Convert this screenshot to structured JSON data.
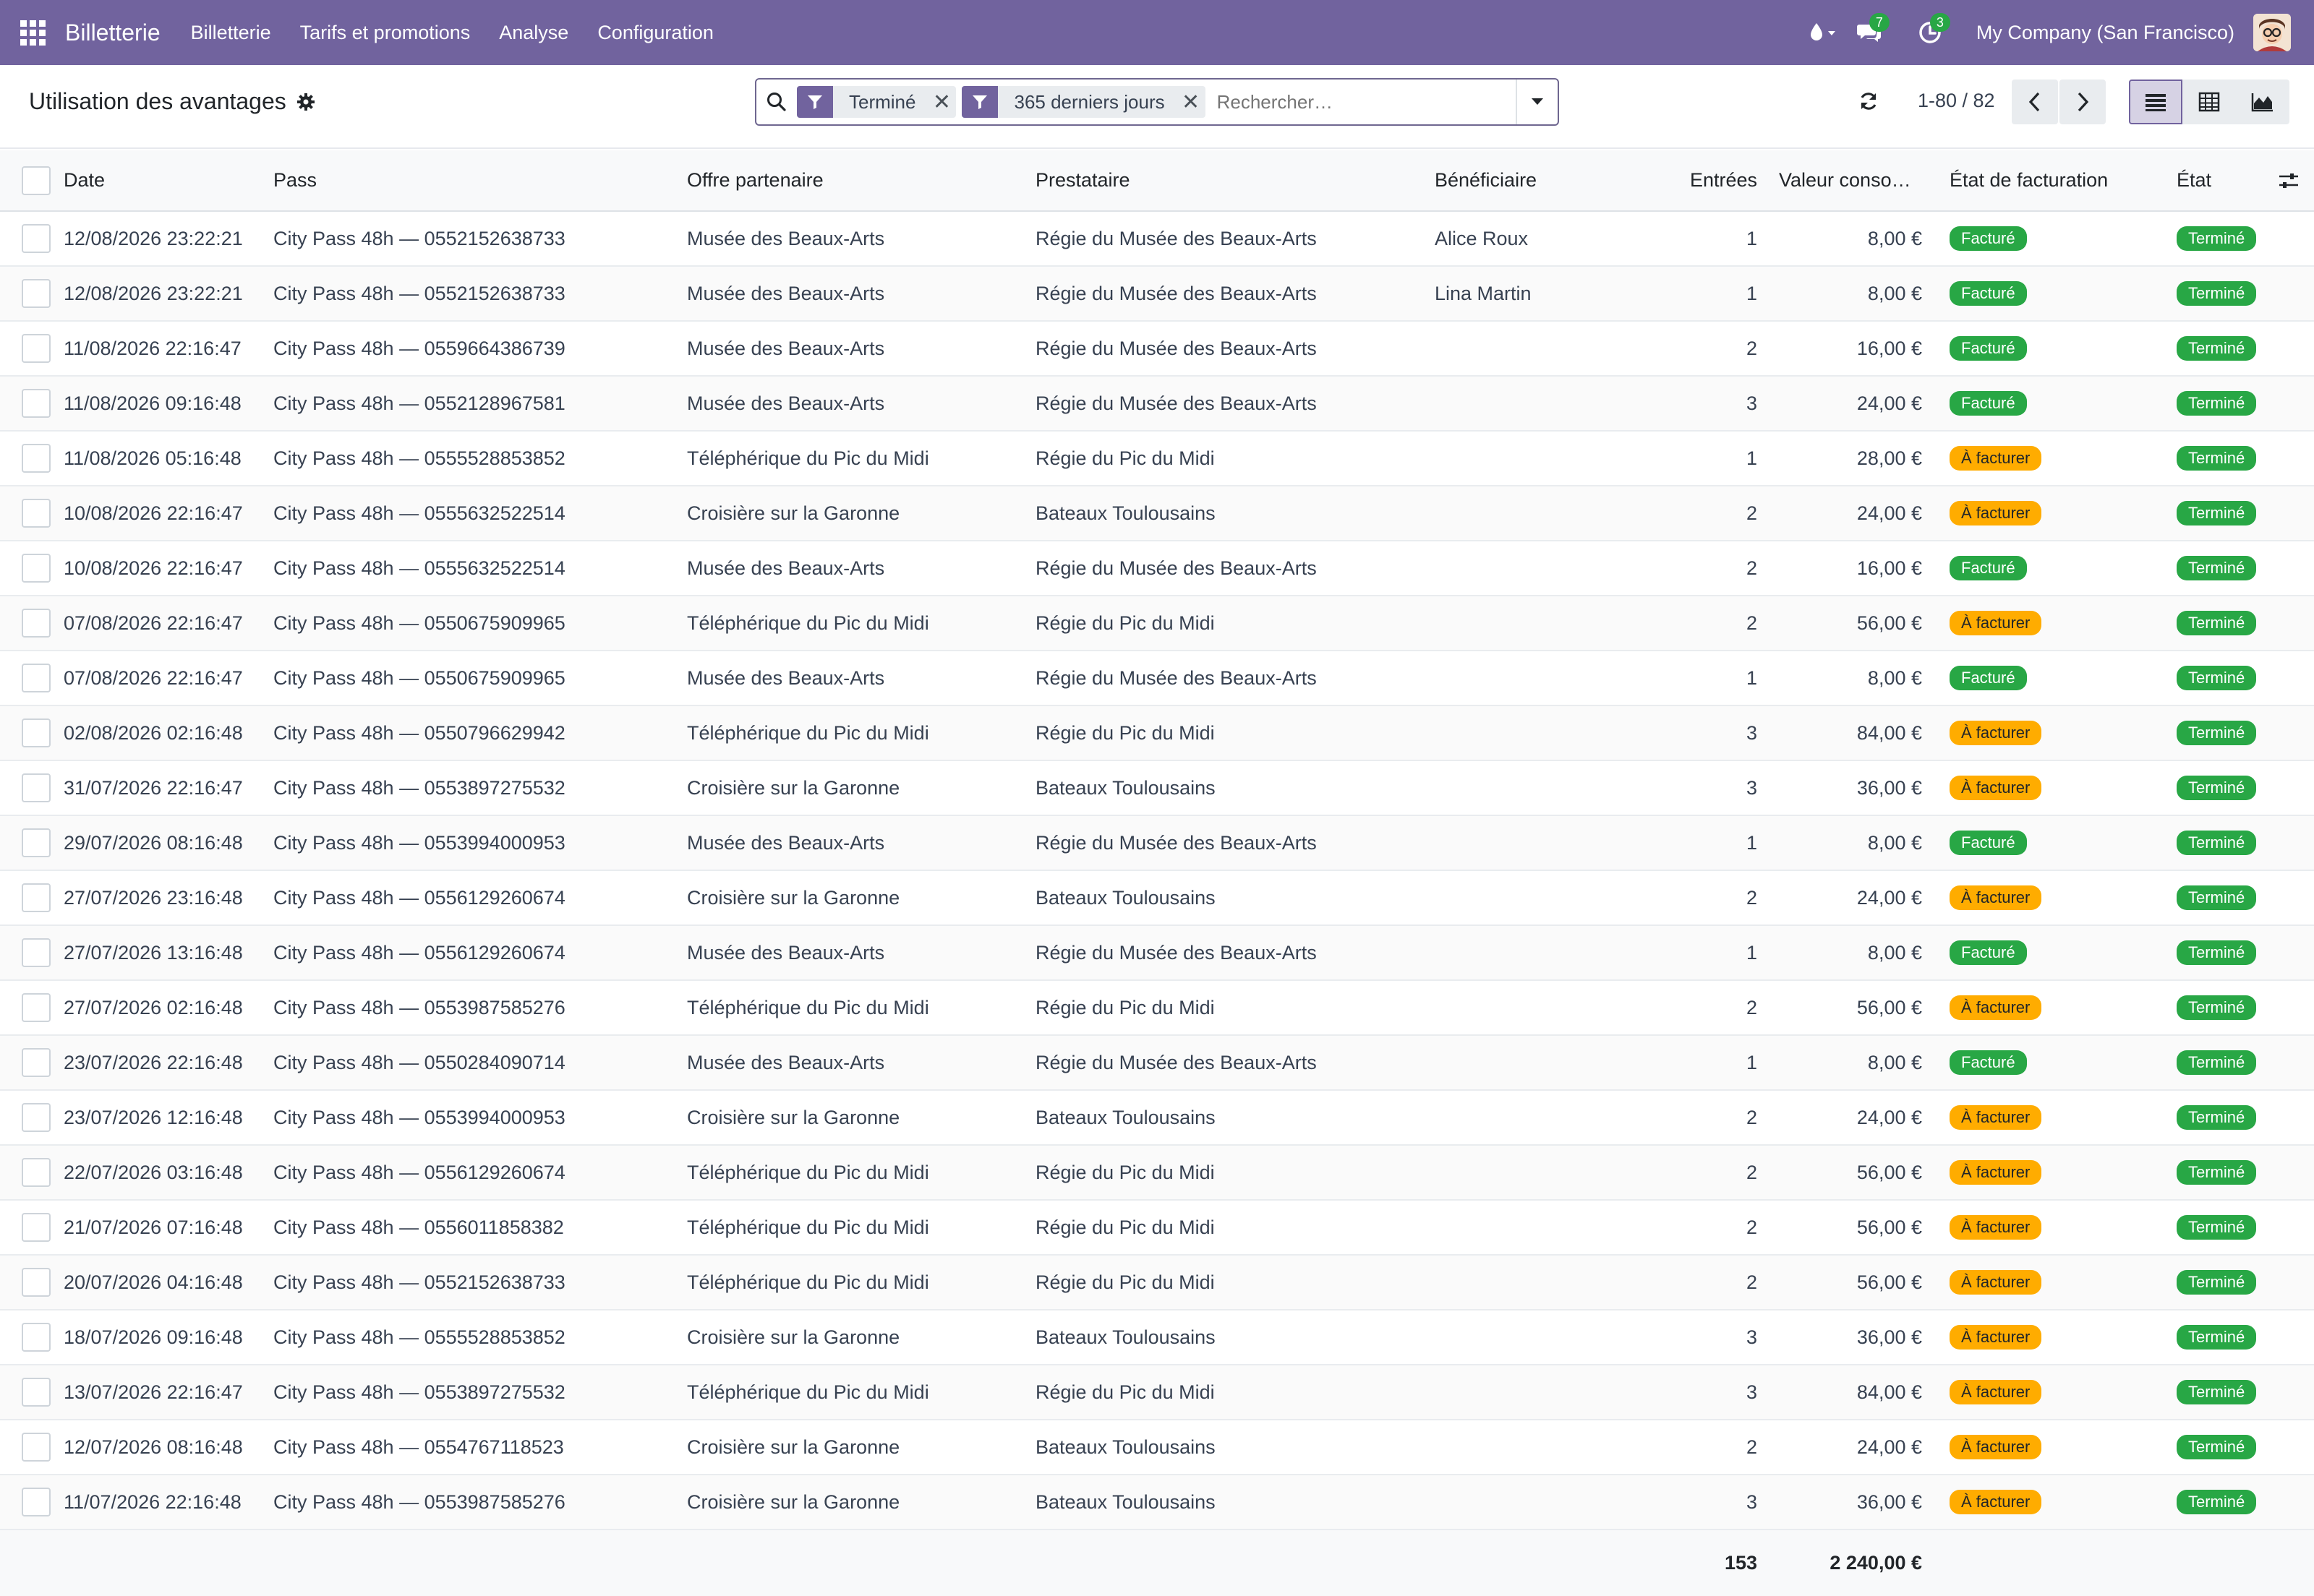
{
  "navbar": {
    "brand": "Billetterie",
    "menu": [
      "Billetterie",
      "Tarifs et promotions",
      "Analyse",
      "Configuration"
    ],
    "messages_count": "7",
    "activities_count": "3",
    "company": "My Company (San Francisco)"
  },
  "control": {
    "title": "Utilisation des avantages",
    "filters": [
      "Terminé",
      "365 derniers jours"
    ],
    "search_placeholder": "Rechercher…",
    "pager": "1-80 / 82"
  },
  "table": {
    "headers": {
      "date": "Date",
      "pass": "Pass",
      "offer": "Offre partenaire",
      "provider": "Prestataire",
      "beneficiary": "Bénéficiaire",
      "entries": "Entrées",
      "value": "Valeur conso…",
      "billing": "État de facturation",
      "state": "État"
    },
    "rows": [
      {
        "date": "12/08/2026 23:22:21",
        "pass": "City Pass 48h — 0552152638733",
        "offer": "Musée des Beaux-Arts",
        "provider": "Régie du Musée des Beaux-Arts",
        "beneficiary": "Alice Roux",
        "entries": "1",
        "value": "8,00 €",
        "billing": "Facturé",
        "state": "Terminé"
      },
      {
        "date": "12/08/2026 23:22:21",
        "pass": "City Pass 48h — 0552152638733",
        "offer": "Musée des Beaux-Arts",
        "provider": "Régie du Musée des Beaux-Arts",
        "beneficiary": "Lina Martin",
        "entries": "1",
        "value": "8,00 €",
        "billing": "Facturé",
        "state": "Terminé"
      },
      {
        "date": "11/08/2026 22:16:47",
        "pass": "City Pass 48h — 0559664386739",
        "offer": "Musée des Beaux-Arts",
        "provider": "Régie du Musée des Beaux-Arts",
        "beneficiary": "",
        "entries": "2",
        "value": "16,00 €",
        "billing": "Facturé",
        "state": "Terminé"
      },
      {
        "date": "11/08/2026 09:16:48",
        "pass": "City Pass 48h — 0552128967581",
        "offer": "Musée des Beaux-Arts",
        "provider": "Régie du Musée des Beaux-Arts",
        "beneficiary": "",
        "entries": "3",
        "value": "24,00 €",
        "billing": "Facturé",
        "state": "Terminé"
      },
      {
        "date": "11/08/2026 05:16:48",
        "pass": "City Pass 48h — 0555528853852",
        "offer": "Téléphérique du Pic du Midi",
        "provider": "Régie du Pic du Midi",
        "beneficiary": "",
        "entries": "1",
        "value": "28,00 €",
        "billing": "À facturer",
        "state": "Terminé"
      },
      {
        "date": "10/08/2026 22:16:47",
        "pass": "City Pass 48h — 0555632522514",
        "offer": "Croisière sur la Garonne",
        "provider": "Bateaux Toulousains",
        "beneficiary": "",
        "entries": "2",
        "value": "24,00 €",
        "billing": "À facturer",
        "state": "Terminé"
      },
      {
        "date": "10/08/2026 22:16:47",
        "pass": "City Pass 48h — 0555632522514",
        "offer": "Musée des Beaux-Arts",
        "provider": "Régie du Musée des Beaux-Arts",
        "beneficiary": "",
        "entries": "2",
        "value": "16,00 €",
        "billing": "Facturé",
        "state": "Terminé"
      },
      {
        "date": "07/08/2026 22:16:47",
        "pass": "City Pass 48h — 0550675909965",
        "offer": "Téléphérique du Pic du Midi",
        "provider": "Régie du Pic du Midi",
        "beneficiary": "",
        "entries": "2",
        "value": "56,00 €",
        "billing": "À facturer",
        "state": "Terminé"
      },
      {
        "date": "07/08/2026 22:16:47",
        "pass": "City Pass 48h — 0550675909965",
        "offer": "Musée des Beaux-Arts",
        "provider": "Régie du Musée des Beaux-Arts",
        "beneficiary": "",
        "entries": "1",
        "value": "8,00 €",
        "billing": "Facturé",
        "state": "Terminé"
      },
      {
        "date": "02/08/2026 02:16:48",
        "pass": "City Pass 48h — 0550796629942",
        "offer": "Téléphérique du Pic du Midi",
        "provider": "Régie du Pic du Midi",
        "beneficiary": "",
        "entries": "3",
        "value": "84,00 €",
        "billing": "À facturer",
        "state": "Terminé"
      },
      {
        "date": "31/07/2026 22:16:47",
        "pass": "City Pass 48h — 0553897275532",
        "offer": "Croisière sur la Garonne",
        "provider": "Bateaux Toulousains",
        "beneficiary": "",
        "entries": "3",
        "value": "36,00 €",
        "billing": "À facturer",
        "state": "Terminé"
      },
      {
        "date": "29/07/2026 08:16:48",
        "pass": "City Pass 48h — 0553994000953",
        "offer": "Musée des Beaux-Arts",
        "provider": "Régie du Musée des Beaux-Arts",
        "beneficiary": "",
        "entries": "1",
        "value": "8,00 €",
        "billing": "Facturé",
        "state": "Terminé"
      },
      {
        "date": "27/07/2026 23:16:48",
        "pass": "City Pass 48h — 0556129260674",
        "offer": "Croisière sur la Garonne",
        "provider": "Bateaux Toulousains",
        "beneficiary": "",
        "entries": "2",
        "value": "24,00 €",
        "billing": "À facturer",
        "state": "Terminé"
      },
      {
        "date": "27/07/2026 13:16:48",
        "pass": "City Pass 48h — 0556129260674",
        "offer": "Musée des Beaux-Arts",
        "provider": "Régie du Musée des Beaux-Arts",
        "beneficiary": "",
        "entries": "1",
        "value": "8,00 €",
        "billing": "Facturé",
        "state": "Terminé"
      },
      {
        "date": "27/07/2026 02:16:48",
        "pass": "City Pass 48h — 0553987585276",
        "offer": "Téléphérique du Pic du Midi",
        "provider": "Régie du Pic du Midi",
        "beneficiary": "",
        "entries": "2",
        "value": "56,00 €",
        "billing": "À facturer",
        "state": "Terminé"
      },
      {
        "date": "23/07/2026 22:16:48",
        "pass": "City Pass 48h — 0550284090714",
        "offer": "Musée des Beaux-Arts",
        "provider": "Régie du Musée des Beaux-Arts",
        "beneficiary": "",
        "entries": "1",
        "value": "8,00 €",
        "billing": "Facturé",
        "state": "Terminé"
      },
      {
        "date": "23/07/2026 12:16:48",
        "pass": "City Pass 48h — 0553994000953",
        "offer": "Croisière sur la Garonne",
        "provider": "Bateaux Toulousains",
        "beneficiary": "",
        "entries": "2",
        "value": "24,00 €",
        "billing": "À facturer",
        "state": "Terminé"
      },
      {
        "date": "22/07/2026 03:16:48",
        "pass": "City Pass 48h — 0556129260674",
        "offer": "Téléphérique du Pic du Midi",
        "provider": "Régie du Pic du Midi",
        "beneficiary": "",
        "entries": "2",
        "value": "56,00 €",
        "billing": "À facturer",
        "state": "Terminé"
      },
      {
        "date": "21/07/2026 07:16:48",
        "pass": "City Pass 48h — 0556011858382",
        "offer": "Téléphérique du Pic du Midi",
        "provider": "Régie du Pic du Midi",
        "beneficiary": "",
        "entries": "2",
        "value": "56,00 €",
        "billing": "À facturer",
        "state": "Terminé"
      },
      {
        "date": "20/07/2026 04:16:48",
        "pass": "City Pass 48h — 0552152638733",
        "offer": "Téléphérique du Pic du Midi",
        "provider": "Régie du Pic du Midi",
        "beneficiary": "",
        "entries": "2",
        "value": "56,00 €",
        "billing": "À facturer",
        "state": "Terminé"
      },
      {
        "date": "18/07/2026 09:16:48",
        "pass": "City Pass 48h — 0555528853852",
        "offer": "Croisière sur la Garonne",
        "provider": "Bateaux Toulousains",
        "beneficiary": "",
        "entries": "3",
        "value": "36,00 €",
        "billing": "À facturer",
        "state": "Terminé"
      },
      {
        "date": "13/07/2026 22:16:47",
        "pass": "City Pass 48h — 0553897275532",
        "offer": "Téléphérique du Pic du Midi",
        "provider": "Régie du Pic du Midi",
        "beneficiary": "",
        "entries": "3",
        "value": "84,00 €",
        "billing": "À facturer",
        "state": "Terminé"
      },
      {
        "date": "12/07/2026 08:16:48",
        "pass": "City Pass 48h — 0554767118523",
        "offer": "Croisière sur la Garonne",
        "provider": "Bateaux Toulousains",
        "beneficiary": "",
        "entries": "2",
        "value": "24,00 €",
        "billing": "À facturer",
        "state": "Terminé"
      },
      {
        "date": "11/07/2026 22:16:48",
        "pass": "City Pass 48h — 0553987585276",
        "offer": "Croisière sur la Garonne",
        "provider": "Bateaux Toulousains",
        "beneficiary": "",
        "entries": "3",
        "value": "36,00 €",
        "billing": "À facturer",
        "state": "Terminé"
      }
    ],
    "totals": {
      "entries": "153",
      "value": "2 240,00 €"
    }
  },
  "colors": {
    "navbar": "#71639e",
    "badge_invoiced": "#28a745",
    "badge_to_invoice": "#ffac00",
    "badge_done": "#28a745"
  }
}
